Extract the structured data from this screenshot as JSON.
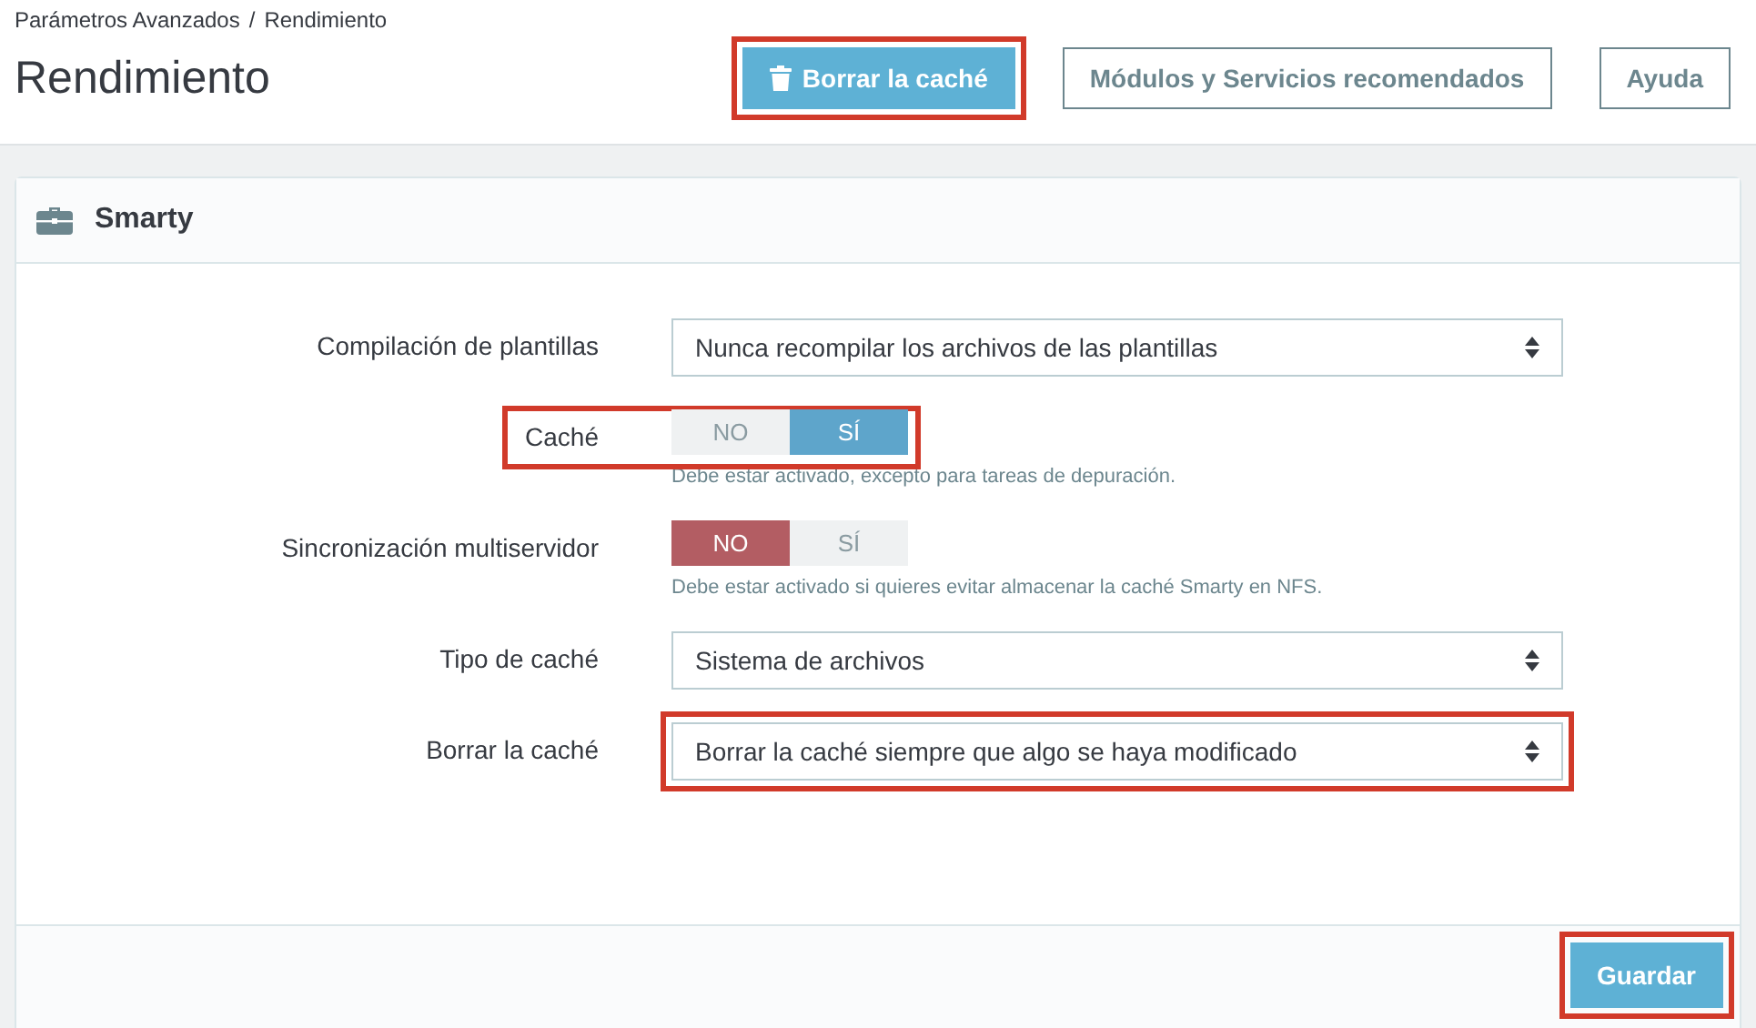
{
  "breadcrumb": {
    "items": [
      "Parámetros Avanzados",
      "Rendimiento"
    ],
    "separator": "/"
  },
  "page_title": "Rendimiento",
  "toolbar_buttons": [
    {
      "label": "Borrar la caché",
      "kind": "primary",
      "highlighted": true
    },
    {
      "label": "Módulos y Servicios recomendados",
      "kind": "outline",
      "highlighted": false
    },
    {
      "label": "Ayuda",
      "kind": "outline",
      "highlighted": false
    }
  ],
  "panel": {
    "title": "Smarty",
    "fields": [
      {
        "kind": "select",
        "label": "Compilación de plantillas",
        "value": "Nunca recompilar los archivos de las plantillas",
        "highlighted": false
      },
      {
        "kind": "switch",
        "label": "Caché",
        "options": [
          {
            "label": "NO",
            "selected": false
          },
          {
            "label": "SÍ",
            "selected": true
          }
        ],
        "help": "Debe estar activado, excepto para tareas de depuración.",
        "highlighted": true
      },
      {
        "kind": "switch",
        "label": "Sincronización multiservidor",
        "options": [
          {
            "label": "NO",
            "selected": true
          },
          {
            "label": "SÍ",
            "selected": false
          }
        ],
        "help": "Debe estar activado si quieres evitar almacenar la caché Smarty en NFS.",
        "highlighted": false
      },
      {
        "kind": "select",
        "label": "Tipo de caché",
        "value": "Sistema de archivos",
        "highlighted": false
      },
      {
        "kind": "select",
        "label": "Borrar la caché",
        "value": "Borrar la caché siempre que algo se haya modificado",
        "highlighted": true
      }
    ],
    "save_button": {
      "label": "Guardar",
      "highlighted": true
    }
  }
}
